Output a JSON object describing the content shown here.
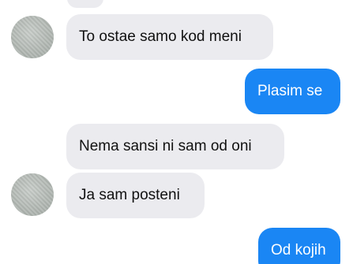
{
  "messages": [
    {
      "text": "To ostae samo kod meni",
      "direction": "incoming"
    },
    {
      "text": "Plasim se",
      "direction": "outgoing"
    },
    {
      "text": "Nema sansi ni sam od oni",
      "direction": "incoming"
    },
    {
      "text": "Ja sam posteni",
      "direction": "incoming"
    },
    {
      "text": "Od kojih",
      "direction": "outgoing"
    }
  ],
  "colors": {
    "incoming_bubble": "#ebebef",
    "outgoing_bubble": "#1a86f4",
    "outgoing_text": "#ffffff",
    "incoming_text": "#111111"
  }
}
